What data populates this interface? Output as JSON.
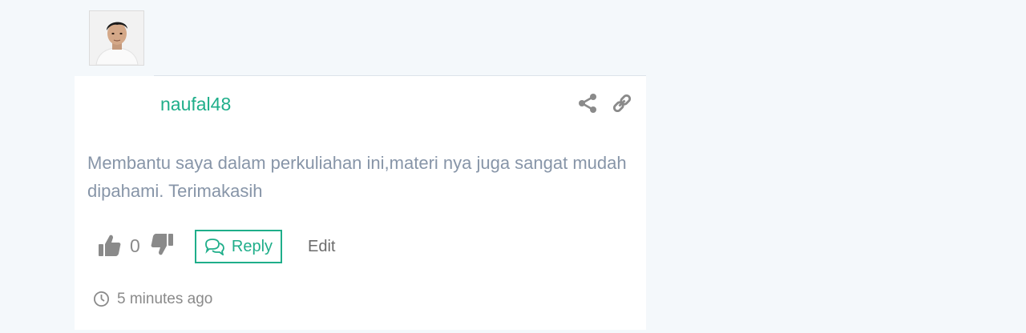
{
  "comment": {
    "author": "naufal48",
    "text": "Membantu saya dalam perkuliahan ini,materi nya juga sangat mudah dipahami. Terimakasih",
    "vote_count": "0",
    "reply_label": "Reply",
    "edit_label": "Edit",
    "timestamp": "5 minutes ago"
  },
  "icons": {
    "avatar": "user-avatar-photo",
    "share": "share-icon",
    "link": "link-icon",
    "like": "thumbs-up-icon",
    "dislike": "thumbs-down-icon",
    "reply": "chat-bubbles-icon",
    "time": "clock-icon"
  },
  "colors": {
    "accent": "#1fae8a",
    "text_muted": "#8795a8",
    "icon_gray": "#8a8a8a",
    "background": "#f4f8fb"
  }
}
